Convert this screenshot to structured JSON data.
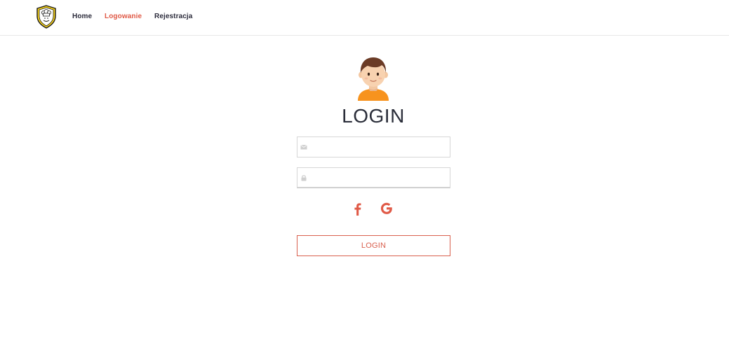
{
  "nav": {
    "logo_icon": "chef-shield-logo",
    "links": [
      {
        "label": "Home",
        "active": false
      },
      {
        "label": "Logowanie",
        "active": true
      },
      {
        "label": "Rejestracja",
        "active": false
      }
    ]
  },
  "login": {
    "avatar_icon": "user-avatar",
    "title": "LOGIN",
    "email_field": {
      "value": "",
      "placeholder": "",
      "icon": "envelope-icon"
    },
    "password_field": {
      "value": "",
      "placeholder": "",
      "icon": "lock-icon"
    },
    "social": [
      {
        "icon": "facebook-icon"
      },
      {
        "icon": "google-icon"
      }
    ],
    "submit_label": "LOGIN"
  },
  "colors": {
    "accent": "#e05a47",
    "text_dark": "#2b2e3a",
    "border": "#d6d6d6"
  }
}
